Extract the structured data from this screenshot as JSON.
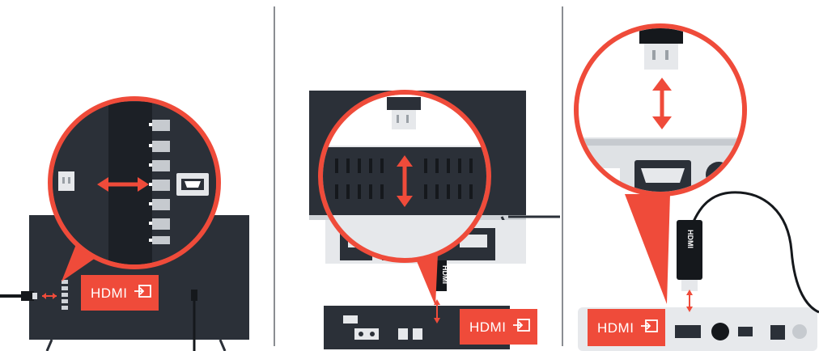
{
  "panels": [
    {
      "badge_label": "HDMI"
    },
    {
      "badge_label": "HDMI"
    },
    {
      "badge_label": "HDMI"
    }
  ],
  "cable_label": "HDMI",
  "colors": {
    "accent_red": "#ef4b3a",
    "device_dark": "#2b3038",
    "device_light": "#e7e9ec",
    "divider": "#8a8d92"
  }
}
